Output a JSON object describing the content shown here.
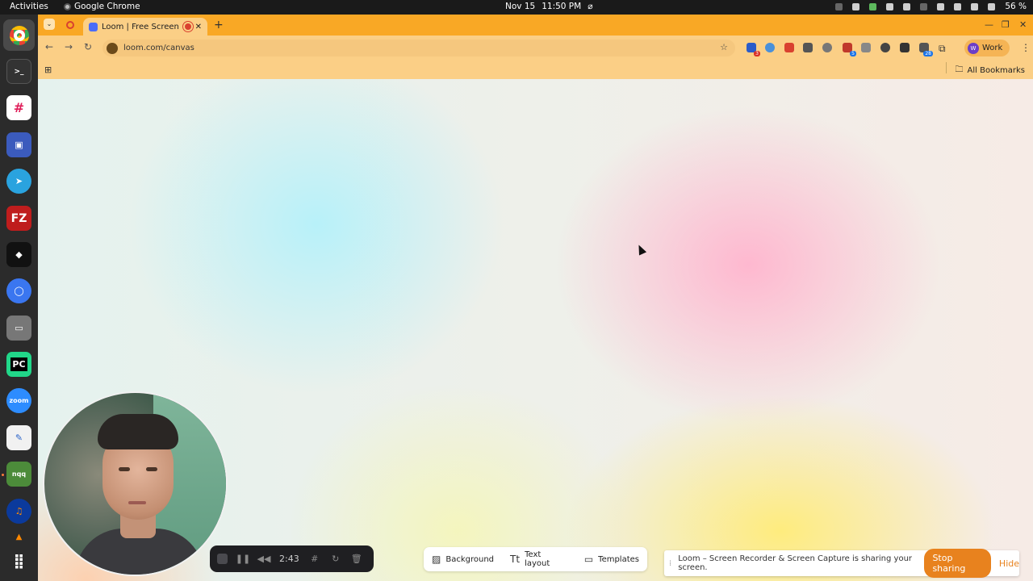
{
  "system": {
    "activities": "Activities",
    "app_name": "Google Chrome",
    "date": "Nov 15",
    "time": "11:50 PM",
    "battery": "56 %"
  },
  "dock": {
    "items": [
      {
        "name": "chrome-icon",
        "label": ""
      },
      {
        "name": "terminal-icon",
        "label": ">_"
      },
      {
        "name": "slack-icon",
        "label": ""
      },
      {
        "name": "remote-desktop-icon",
        "label": ""
      },
      {
        "name": "telegram-icon",
        "label": ""
      },
      {
        "name": "filezilla-icon",
        "label": "FZ"
      },
      {
        "name": "unity-icon",
        "label": ""
      },
      {
        "name": "signal-icon",
        "label": ""
      },
      {
        "name": "files-icon",
        "label": ""
      },
      {
        "name": "pycharm-icon",
        "label": "PC"
      },
      {
        "name": "zoom-icon",
        "label": "zoom"
      },
      {
        "name": "text-editor-icon",
        "label": ""
      },
      {
        "name": "nqq-icon",
        "label": "nqq"
      },
      {
        "name": "audacity-icon",
        "label": ""
      },
      {
        "name": "vlc-icon",
        "label": ""
      },
      {
        "name": "app-grid-icon",
        "label": ""
      }
    ]
  },
  "browser": {
    "tab_title": "Loom | Free Screen &",
    "url": "loom.com/canvas",
    "profile_label": "Work",
    "all_bookmarks": "All Bookmarks",
    "ext_badge_1": "3",
    "ext_badge_2": "5",
    "ext_badge_3": "28"
  },
  "recording": {
    "elapsed": "2:43"
  },
  "canvas_options": {
    "background": "Background",
    "text_layout": "Text layout",
    "templates": "Templates"
  },
  "sharing_banner": {
    "message": "Loom – Screen Recorder & Screen Capture is sharing your screen.",
    "stop_label": "Stop sharing",
    "hide_label": "Hide"
  },
  "colors": {
    "tab_strip": "#f9a825",
    "toolbar": "#fbcf86",
    "accent": "#e8821e"
  }
}
